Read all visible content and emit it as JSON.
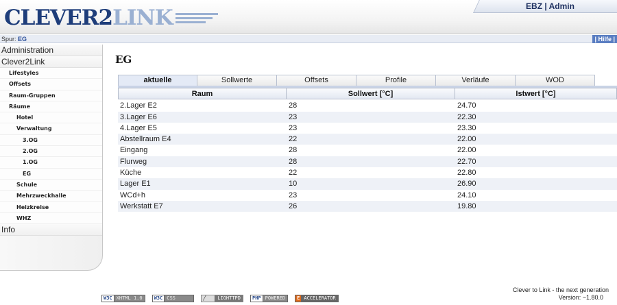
{
  "header": {
    "logo_part1": "CLEVER2",
    "logo_part2": "LINK",
    "user_label": "EBZ | Admin"
  },
  "trail": {
    "prefix": "Spur:",
    "current": "EG",
    "help": "| Hilfe |"
  },
  "sidebar": {
    "top_items": [
      "Administration",
      "Clever2Link"
    ],
    "sub_items": [
      {
        "label": "Lifestyles",
        "level": 1
      },
      {
        "label": "Offsets",
        "level": 1
      },
      {
        "label": "Raum-Gruppen",
        "level": 1
      },
      {
        "label": "Räume",
        "level": 1
      },
      {
        "label": "Hotel",
        "level": 2
      },
      {
        "label": "Verwaltung",
        "level": 2
      },
      {
        "label": "3.OG",
        "level": 3
      },
      {
        "label": "2.OG",
        "level": 3
      },
      {
        "label": "1.OG",
        "level": 3
      },
      {
        "label": "EG",
        "level": 3
      },
      {
        "label": "Schule",
        "level": 2
      },
      {
        "label": "Mehrzweckhalle",
        "level": 2
      },
      {
        "label": "Heizkreise",
        "level": 2
      },
      {
        "label": "WHZ",
        "level": 2
      }
    ],
    "bottom_item": "Info"
  },
  "main": {
    "title": "EG",
    "tabs": [
      "aktuelle",
      "Sollwerte",
      "Offsets",
      "Profile",
      "Verläufe",
      "WOD"
    ],
    "active_tab": "aktuelle",
    "columns": [
      "Raum",
      "Sollwert [°C]",
      "Istwert [°C]"
    ],
    "rows": [
      [
        "2.Lager E2",
        "28",
        "24.70"
      ],
      [
        "3.Lager E6",
        "23",
        "22.30"
      ],
      [
        "4.Lager E5",
        "23",
        "23.30"
      ],
      [
        "Abstellraum E4",
        "22",
        "22.00"
      ],
      [
        "Eingang",
        "28",
        "22.00"
      ],
      [
        "Flurweg",
        "28",
        "22.70"
      ],
      [
        "Küche",
        "22",
        "22.80"
      ],
      [
        "Lager E1",
        "10",
        "26.90"
      ],
      [
        "WCd+h",
        "23",
        "24.10"
      ],
      [
        "Werkstatt E7",
        "26",
        "19.80"
      ]
    ]
  },
  "footer": {
    "badges": [
      {
        "left": "W3C",
        "right": "XHTML 1.0",
        "icon": "w3c-xhtml-badge"
      },
      {
        "left": "W3C",
        "right": "CSS",
        "icon": "w3c-css-badge"
      },
      {
        "left": "",
        "right": "LIGHTTPD",
        "icon": "lighttpd-badge"
      },
      {
        "left": "PHP",
        "right": "POWERED",
        "icon": "php-powered-badge"
      },
      {
        "left": "E",
        "right": "ACCELERATOR",
        "icon": "eaccelerator-badge"
      }
    ],
    "tagline": "Clever to Link - the next generation",
    "version": "Version: ~1.80.0"
  },
  "colors": {
    "brand_dark": "#1e3d7a",
    "brand_light": "#9ab0d2",
    "help_bg": "#5a7ec2",
    "row_alt": "#eef1f7"
  }
}
